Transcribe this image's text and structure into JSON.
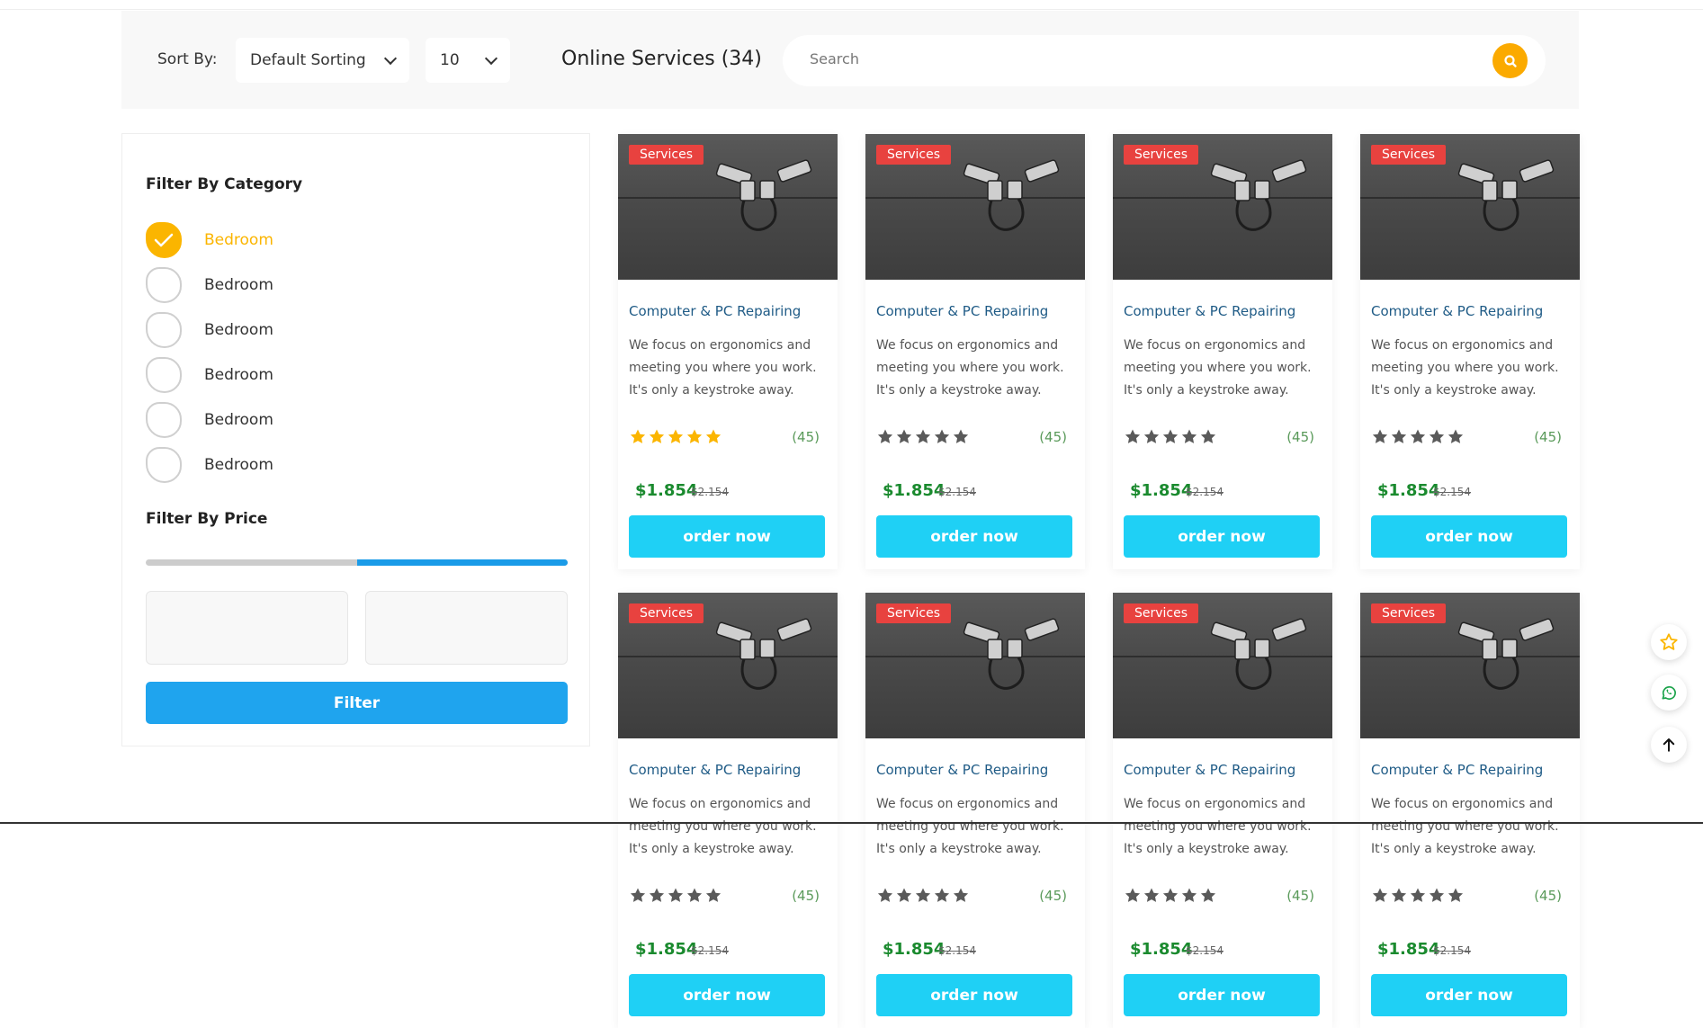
{
  "toolbar": {
    "sort_label": "Sort By:",
    "sort_value": "Default Sorting",
    "count_value": "10",
    "title": "Online Services (34)",
    "search_placeholder": "Search"
  },
  "sidebar": {
    "category_title": "Filter By Category",
    "categories": [
      {
        "label": "Bedroom",
        "checked": true
      },
      {
        "label": "Bedroom",
        "checked": false
      },
      {
        "label": "Bedroom",
        "checked": false
      },
      {
        "label": "Bedroom",
        "checked": false
      },
      {
        "label": "Bedroom",
        "checked": false
      },
      {
        "label": "Bedroom",
        "checked": false
      }
    ],
    "price_title": "Filter By Price",
    "price_range_fill": {
      "start": 0.5,
      "end": 1.0
    },
    "filter_label": "Filter"
  },
  "cards": [
    {
      "badge": "Services",
      "title": "Computer & PC Repairing",
      "desc": "We focus on ergonomics and meeting you where you work. It's only a keystroke away.",
      "rating": 5,
      "reviews": "(45)",
      "price": "$1.854",
      "old_price": "$2.154",
      "button": "order now"
    },
    {
      "badge": "Services",
      "title": "Computer & PC Repairing",
      "desc": "We focus on ergonomics and meeting you where you work. It's only a keystroke away.",
      "rating": 0,
      "reviews": "(45)",
      "price": "$1.854",
      "old_price": "$2.154",
      "button": "order now"
    },
    {
      "badge": "Services",
      "title": "Computer & PC Repairing",
      "desc": "We focus on ergonomics and meeting you where you work. It's only a keystroke away.",
      "rating": 0,
      "reviews": "(45)",
      "price": "$1.854",
      "old_price": "$2.154",
      "button": "order now"
    },
    {
      "badge": "Services",
      "title": "Computer & PC Repairing",
      "desc": "We focus on ergonomics and meeting you where you work. It's only a keystroke away.",
      "rating": 0,
      "reviews": "(45)",
      "price": "$1.854",
      "old_price": "$2.154",
      "button": "order now"
    },
    {
      "badge": "Services",
      "title": "Computer & PC Repairing",
      "desc": "We focus on ergonomics and meeting you where you work. It's only a keystroke away.",
      "rating": 0,
      "reviews": "(45)",
      "price": "$1.854",
      "old_price": "$2.154",
      "button": "order now"
    },
    {
      "badge": "Services",
      "title": "Computer & PC Repairing",
      "desc": "We focus on ergonomics and meeting you where you work. It's only a keystroke away.",
      "rating": 0,
      "reviews": "(45)",
      "price": "$1.854",
      "old_price": "$2.154",
      "button": "order now"
    },
    {
      "badge": "Services",
      "title": "Computer & PC Repairing",
      "desc": "We focus on ergonomics and meeting you where you work. It's only a keystroke away.",
      "rating": 0,
      "reviews": "(45)",
      "price": "$1.854",
      "old_price": "$2.154",
      "button": "order now"
    },
    {
      "badge": "Services",
      "title": "Computer & PC Repairing",
      "desc": "We focus on ergonomics and meeting you where you work. It's only a keystroke away.",
      "rating": 0,
      "reviews": "(45)",
      "price": "$1.854",
      "old_price": "$2.154",
      "button": "order now"
    }
  ],
  "floating": {
    "favorite_icon": "star-icon",
    "whatsapp_icon": "whatsapp-icon",
    "scroll_top_icon": "arrow-up-icon"
  },
  "colors": {
    "accent": "#fbaa00",
    "badge": "#e8423f",
    "order_button": "#1fd0f5",
    "filter_button": "#1fa4ee",
    "price": "#1a8a2e",
    "star_filled": "#fbb500",
    "star_empty": "#5a5a5a"
  }
}
